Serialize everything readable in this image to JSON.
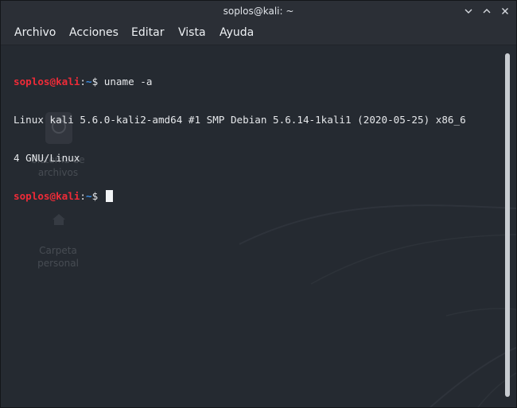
{
  "window": {
    "title": "soplos@kali: ~"
  },
  "menu": {
    "items": [
      {
        "label": "Archivo"
      },
      {
        "label": "Acciones"
      },
      {
        "label": "Editar"
      },
      {
        "label": "Vista"
      },
      {
        "label": "Ayuda"
      }
    ]
  },
  "desktop": {
    "icons": [
      {
        "label_line1": "Sistema de",
        "label_line2": "archivos",
        "icon": "hard-drive-icon"
      },
      {
        "label_line1": "Carpeta",
        "label_line2": "personal",
        "icon": "home-icon"
      }
    ]
  },
  "terminal": {
    "prompt_user": "soplos@kali",
    "prompt_sep": ":",
    "prompt_path": "~",
    "prompt_symbol": "$ ",
    "command": "uname -a",
    "output_line1": "Linux kali 5.6.0-kali2-amd64 #1 SMP Debian 5.6.14-1kali1 (2020-05-25) x86_6",
    "output_line2": "4 GNU/Linux"
  },
  "colors": {
    "background": "#252a31",
    "prompt_user": "#ef2b38",
    "prompt_path": "#3a8ee6",
    "text": "#e6e8eb"
  }
}
